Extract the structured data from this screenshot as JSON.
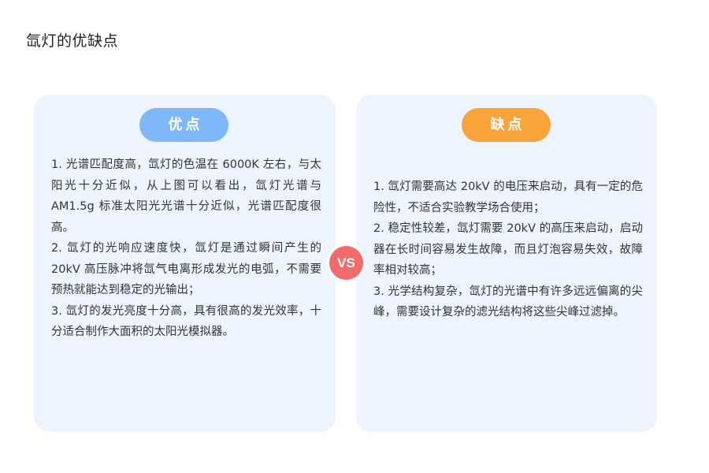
{
  "title": "氙灯的优缺点",
  "pros": {
    "label": "优点",
    "color": "#7fb8f8",
    "items": [
      "1. 光谱匹配度高，氙灯的色温在 6000K 左右，与太阳光十分近似，从上图可以看出，氙灯光谱与AM1.5g 标准太阳光光谱十分近似，光谱匹配度很高。",
      "2. 氙灯的光响应速度快，氙灯是通过瞬间产生的 20kV 高压脉冲将氙气电离形成发光的电弧，不需要预热就能达到稳定的光输出；",
      "3. 氙灯的发光亮度十分高，具有很高的发光效率，十分适合制作大面积的太阳光模拟器。"
    ]
  },
  "vs": {
    "label": "VS",
    "color": "#f26b6b"
  },
  "cons": {
    "label": "缺点",
    "color": "#f9a43a",
    "items": [
      "1. 氙灯需要高达 20kV 的电压来启动，具有一定的危险性，不适合实验教学场合使用；",
      "2. 稳定性较差，氙灯需要 20kV 的高压来启动，启动器在长时间容易发生故障，而且灯泡容易失效，故障率相对较高；",
      "3. 光学结构复杂，氙灯的光谱中有许多远远偏离的尖峰，需要设计复杂的滤光结构将这些尖峰过滤掉。"
    ]
  },
  "card_background": "#eef4fe"
}
